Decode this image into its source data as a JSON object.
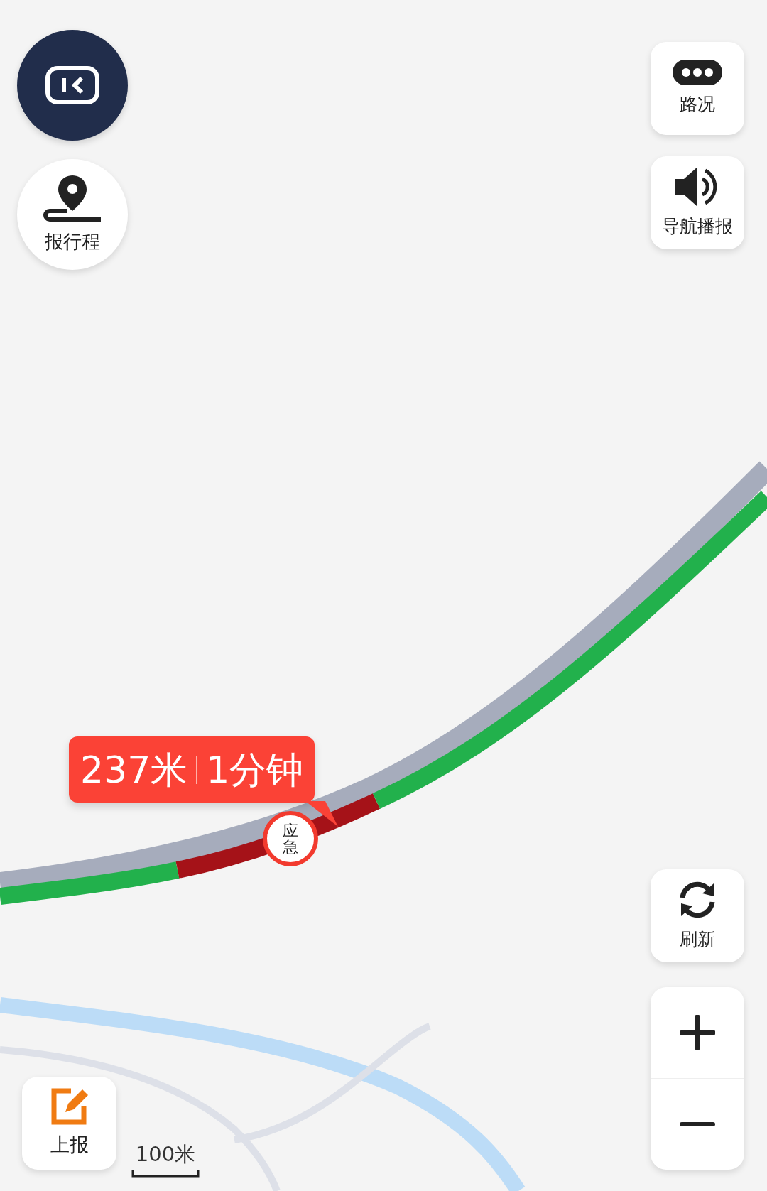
{
  "left_controls": [
    {
      "kind": "exit"
    },
    {
      "kind": "trip",
      "label": "报行程"
    }
  ],
  "right_controls": [
    {
      "kind": "traffic",
      "label": "路况"
    },
    {
      "kind": "voice",
      "label": "导航播报"
    },
    {
      "kind": "refresh",
      "label": "刷新"
    }
  ],
  "route_bubble": {
    "distance": "237米",
    "time": "1分钟"
  },
  "marker": {
    "label": "应急"
  },
  "zoom": [
    {
      "kind": "plus"
    },
    {
      "kind": "minus"
    }
  ],
  "report": {
    "label": "上报"
  },
  "scale": "100米"
}
